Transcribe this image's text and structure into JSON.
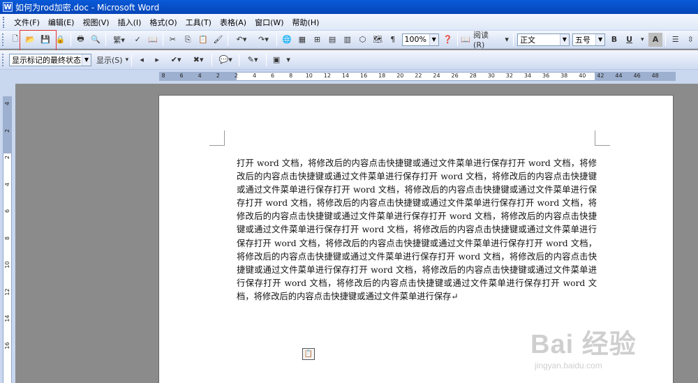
{
  "window": {
    "title": "如何为rod加密.doc - Microsoft Word"
  },
  "menu": [
    "文件(F)",
    "编辑(E)",
    "视图(V)",
    "插入(I)",
    "格式(O)",
    "工具(T)",
    "表格(A)",
    "窗口(W)",
    "帮助(H)"
  ],
  "toolbar1": {
    "zoom_value": "100%",
    "read_label": "阅读(R)",
    "style_value": "正文",
    "size_value": "五号",
    "bold": "B",
    "underline": "U",
    "char_style": "A"
  },
  "toolbar2": {
    "markup_value": "显示标记的最终状态",
    "show_label": "显示(S)"
  },
  "ruler": {
    "h_ticks": [
      "8",
      "6",
      "4",
      "2",
      "2",
      "4",
      "6",
      "8",
      "10",
      "12",
      "14",
      "16",
      "18",
      "20",
      "22",
      "24",
      "26",
      "28",
      "30",
      "32",
      "34",
      "36",
      "38",
      "40",
      "42",
      "44",
      "46",
      "48"
    ],
    "v_ticks": [
      "4",
      "2",
      "2",
      "4",
      "6",
      "8",
      "10",
      "12",
      "14",
      "16"
    ]
  },
  "document": {
    "text": "打开 word 文档，将修改后的内容点击快捷键或通过文件菜单进行保存打开 word 文档，将修改后的内容点击快捷键或通过文件菜单进行保存打开 word 文档，将修改后的内容点击快捷键或通过文件菜单进行保存打开 word 文档，将修改后的内容点击快捷键或通过文件菜单进行保存打开 word 文档，将修改后的内容点击快捷键或通过文件菜单进行保存打开 word 文档，将修改后的内容点击快捷键或通过文件菜单进行保存打开 word 文档，将修改后的内容点击快捷键或通过文件菜单进行保存打开 word 文档，将修改后的内容点击快捷键或通过文件菜单进行保存打开 word 文档，将修改后的内容点击快捷键或通过文件菜单进行保存打开 word 文档，将修改后的内容点击快捷键或通过文件菜单进行保存打开 word 文档，将修改后的内容点击快捷键或通过文件菜单进行保存打开 word 文档，将修改后的内容点击快捷键或通过文件菜单进行保存打开 word 文档，将修改后的内容点击快捷键或通过文件菜单进行保存打开 word 文档，将修改后的内容点击快捷键或通过文件菜单进行保存↵"
  },
  "watermark": {
    "main": "Bai 经验",
    "sub": "jingyan.baidu.com"
  }
}
